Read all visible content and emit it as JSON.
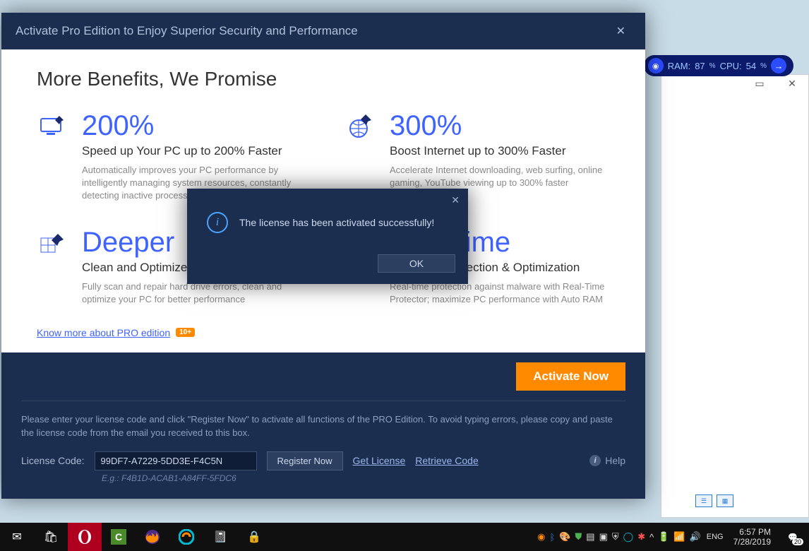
{
  "perf": {
    "ram_label": "RAM:",
    "ram_value": "87",
    "cpu_label": "CPU:",
    "cpu_value": "54",
    "pct": "%"
  },
  "titlebar": {
    "title": "Activate Pro Edition to Enjoy Superior Security and Performance"
  },
  "heading": "More Benefits, We Promise",
  "benefits": [
    {
      "big": "200%",
      "sub": "Speed up Your PC up to 200% Faster",
      "desc": "Automatically improves your PC performance by intelligently managing system resources, constantly detecting inactive processes, and freeing up RAM"
    },
    {
      "big": "300%",
      "sub": "Boost Internet up to 300% Faster",
      "desc": "Accelerate Internet downloading, web surfing, online gaming, YouTube viewing up to 300% faster"
    },
    {
      "big": "Deeper",
      "sub": "Clean and Optimize PC Deeply",
      "desc": "Fully scan and repair hard drive errors, clean and optimize your PC for better performance"
    },
    {
      "big": "Real-time",
      "sub": "Real-time Protection & Optimization",
      "desc": "Real-time protection against malware with Real-Time Protector; maximize PC performance with Auto RAM"
    }
  ],
  "know_more": "Know more about PRO edition",
  "badge": "10+",
  "activate_btn": "Activate Now",
  "instructions": "Please enter your license code and click \"Register Now\" to activate all functions of the PRO Edition. To avoid typing errors, please copy and paste the license code from the email you received to this box.",
  "license": {
    "label": "License Code:",
    "value": "99DF7-A7229-5DD3E-F4C5N",
    "register": "Register Now",
    "get": "Get License",
    "retrieve": "Retrieve Code",
    "help": "Help",
    "example": "E.g.: F4B1D-ACAB1-A84FF-5FDC6"
  },
  "modal": {
    "message": "The license has been activated successfully!",
    "ok": "OK"
  },
  "taskbar": {
    "lang": "ENG",
    "time": "6:57 PM",
    "date": "7/28/2019",
    "notif_count": "20"
  }
}
